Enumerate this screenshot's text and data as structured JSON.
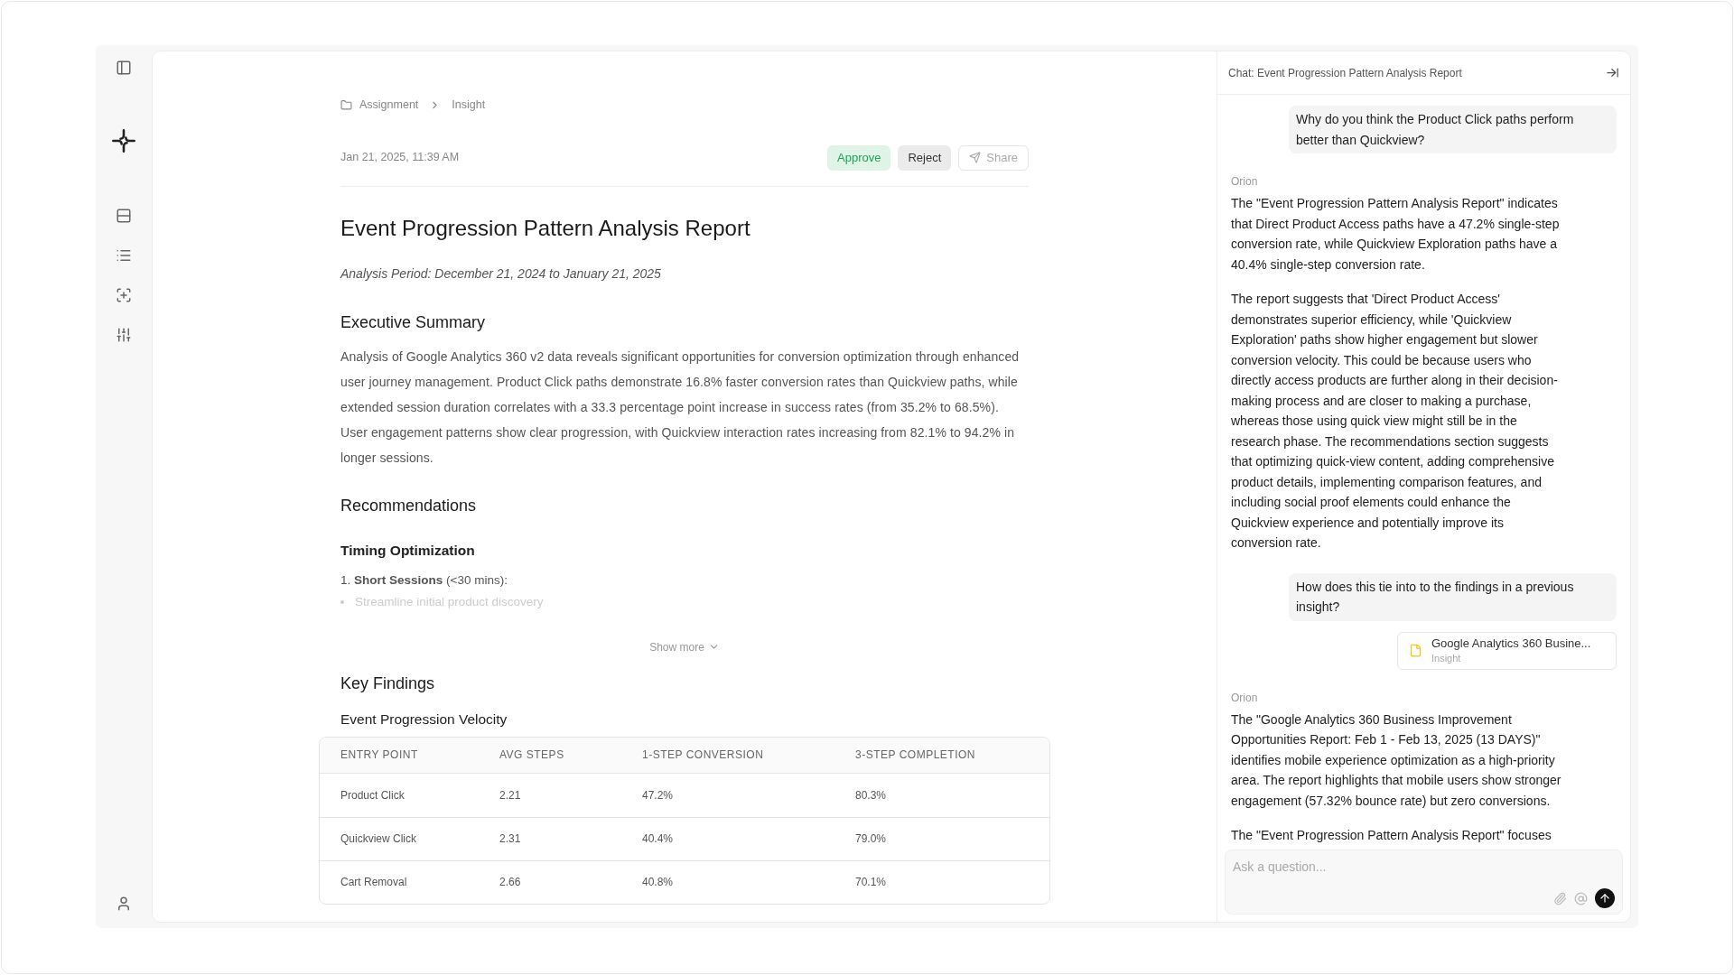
{
  "sidebar": {
    "items": [
      {
        "kind": "toggle"
      },
      {
        "kind": "logo"
      },
      {
        "kind": "stack"
      },
      {
        "kind": "list"
      },
      {
        "kind": "scan"
      },
      {
        "kind": "sliders"
      },
      {
        "kind": "user"
      }
    ]
  },
  "breadcrumb": [
    "Assignment",
    "Insight"
  ],
  "report": {
    "date": "Jan 21, 2025, 11:39 AM",
    "actions": [
      {
        "kind": "approve",
        "label": "Approve"
      },
      {
        "kind": "reject",
        "label": "Reject"
      },
      {
        "kind": "share",
        "label": "Share"
      }
    ],
    "title": "Event Progression Pattern Analysis Report",
    "period": "Analysis Period: December 21, 2024 to January 21, 2025",
    "summary_heading": "Executive Summary",
    "summary": "Analysis of Google Analytics 360 v2 data reveals significant opportunities for conversion optimization through enhanced user journey management. Product Click paths demonstrate 16.8% faster conversion rates than Quickview paths, while extended session duration correlates with a 33.3 percentage point increase in success rates (from 35.2% to 68.5%). User engagement patterns show clear progression, with Quickview interaction rates increasing from 82.1% to 94.2% in longer sessions.",
    "recommendations_heading": "Recommendations",
    "sub_heading": "Timing Optimization",
    "numbered_item": "1. **Short Sessions** (<30 mins):",
    "bullets": [
      "Streamline initial product discovery"
    ],
    "show_more": "Show more",
    "findings_heading": "Key Findings",
    "table_title": "Event Progression Velocity",
    "table": {
      "columns": [
        "ENTRY POINT",
        "AVG STEPS",
        "1-STEP CONVERSION",
        "3-STEP COMPLETION"
      ],
      "rows": [
        [
          "Product Click",
          "2.21",
          "47.2%",
          "80.3%"
        ],
        [
          "Quickview Click",
          "2.31",
          "40.4%",
          "79.0%"
        ],
        [
          "Cart Removal",
          "2.66",
          "40.8%",
          "70.1%"
        ]
      ]
    }
  },
  "chat": {
    "title": "Chat: Event Progression Pattern Analysis Report",
    "messages": [
      {
        "kind": "user",
        "text": "Why do you think the Product Click paths perform better than Quickview?"
      },
      {
        "kind": "assistant",
        "author": "Orion",
        "paragraphs": [
          "The \"Event Progression Pattern Analysis Report\" indicates that Direct Product Access paths have a 47.2% single-step conversion rate, while Quickview Exploration paths have a 40.4% single-step conversion rate.",
          "The report suggests that 'Direct Product Access' demonstrates superior efficiency, while 'Quickview Exploration' paths show higher engagement but slower conversion velocity. This could be because users who directly access products are further along in their decision-making process and are closer to making a purchase, whereas those using quick view might still be in the research phase. The recommendations section suggests that optimizing quick-view content, adding comprehensive product details, implementing comparison features, and including social proof elements could enhance the Quickview experience and potentially improve its conversion rate."
        ]
      },
      {
        "kind": "user",
        "text": "How does this tie into to the findings in a previous insight?"
      },
      {
        "kind": "attachment",
        "title": "Google Analytics 360 Busine...",
        "subtitle": "Insight"
      },
      {
        "kind": "assistant",
        "author": "Orion",
        "paragraphs": [
          "The \"Google Analytics 360 Business Improvement Opportunities Report: Feb 1 - Feb 13, 2025 (13 DAYS)\" identifies mobile experience optimization as a high-priority area. The report highlights that mobile users show stronger engagement (57.32% bounce rate) but zero conversions.",
          "The \"Event Progression Pattern Analysis Report\" focuses"
        ]
      }
    ],
    "input": {
      "placeholder": "Ask a question..."
    }
  }
}
